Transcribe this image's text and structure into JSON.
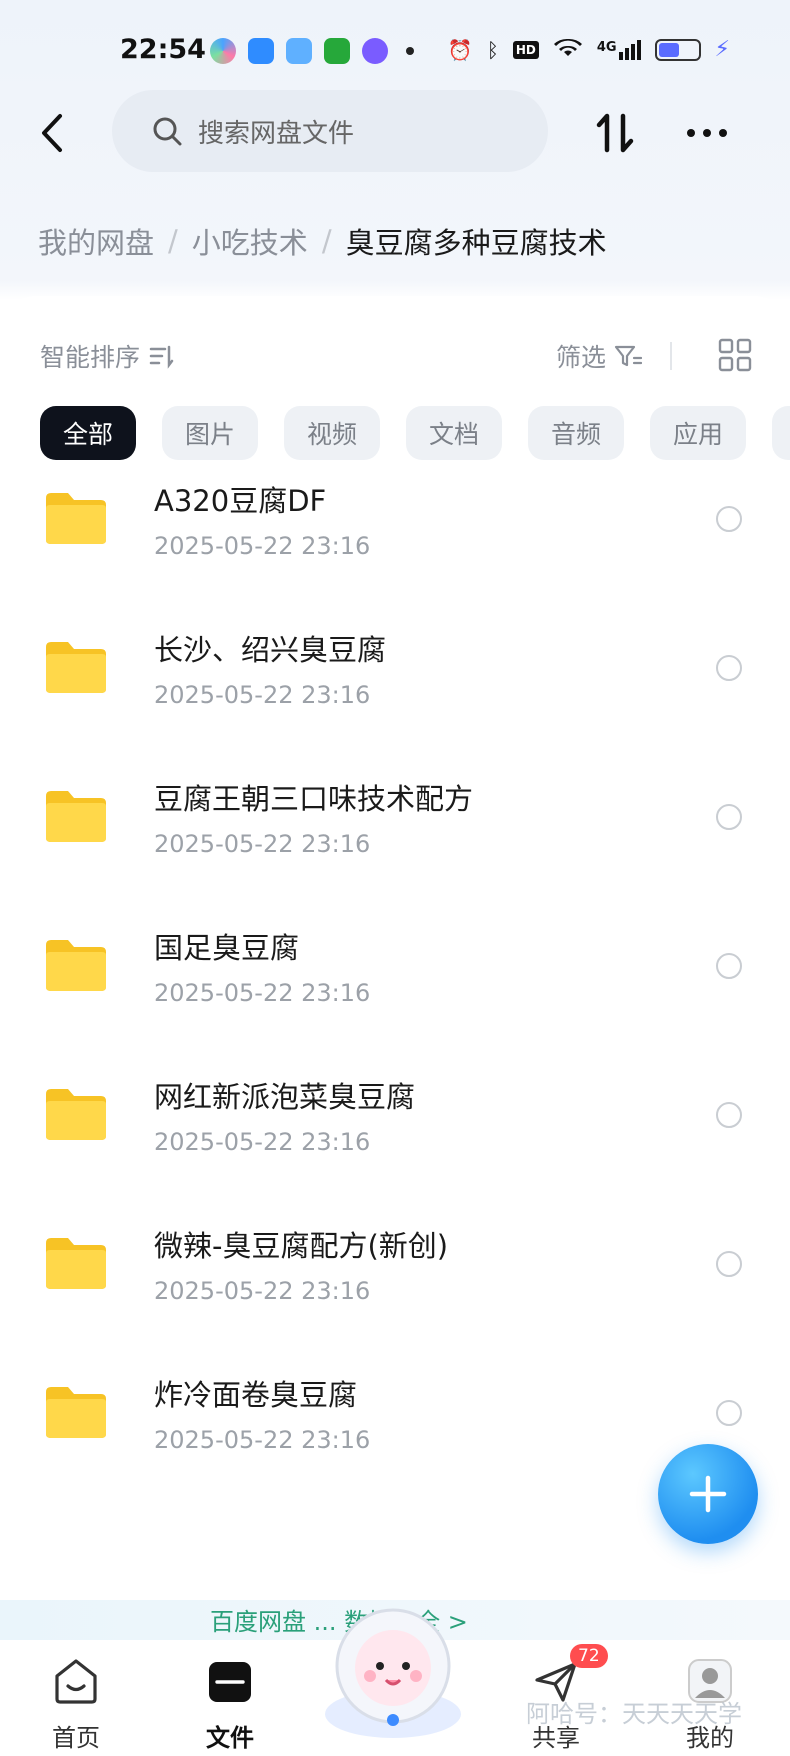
{
  "status_bar": {
    "time": "22:54",
    "network": "4G",
    "hd": "HD"
  },
  "top_bar": {
    "search_placeholder": "搜索网盘文件"
  },
  "breadcrumb": {
    "items": [
      "我的网盘",
      "小吃技术",
      "臭豆腐多种豆腐技术"
    ],
    "separator": "/"
  },
  "toolbar": {
    "sort_label": "智能排序",
    "filter_label": "筛选"
  },
  "filter_chips": [
    "全部",
    "图片",
    "视频",
    "文档",
    "音频",
    "应用"
  ],
  "files": [
    {
      "name": "A320豆腐DF",
      "date": "2025-05-22  23:16"
    },
    {
      "name": "长沙、绍兴臭豆腐",
      "date": "2025-05-22  23:16"
    },
    {
      "name": "豆腐王朝三口味技术配方",
      "date": "2025-05-22  23:16"
    },
    {
      "name": "国足臭豆腐",
      "date": "2025-05-22  23:16"
    },
    {
      "name": "网红新派泡菜臭豆腐",
      "date": "2025-05-22  23:16"
    },
    {
      "name": "微辣-臭豆腐配方(新创)",
      "date": "2025-05-22  23:16"
    },
    {
      "name": "炸冷面卷臭豆腐",
      "date": "2025-05-22  23:16"
    }
  ],
  "banner": {
    "text": "百度网盘 ... 数据安全 >"
  },
  "bottom_nav": {
    "home": "首页",
    "files": "文件",
    "share": "共享",
    "share_badge": "72",
    "mine": "我的"
  },
  "watermark": "阿哈号：天天天天学",
  "colors": {
    "accent": "#1f8ef0",
    "folder": "#ffd43b",
    "active_chip": "#0e121c",
    "badge": "#ff4d4f"
  }
}
